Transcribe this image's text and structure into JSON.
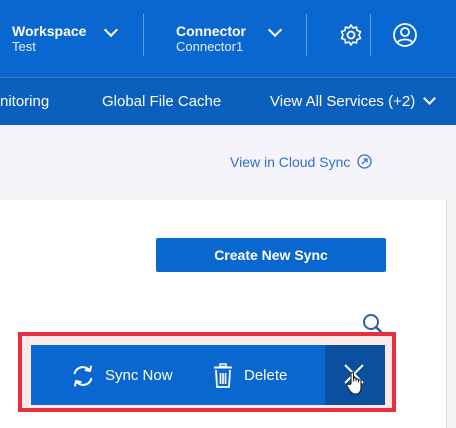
{
  "topbar": {
    "workspace": {
      "title": "Workspace",
      "value": "Test"
    },
    "connector": {
      "title": "Connector",
      "value": "Connector1"
    },
    "icons": [
      "gear-icon",
      "user-icon",
      "chevron-down-icon"
    ]
  },
  "nav": {
    "items": [
      {
        "label": "nitoring"
      },
      {
        "label": "Global File Cache"
      },
      {
        "label": "View All Services (+2)"
      }
    ]
  },
  "header_link": {
    "label": "View in Cloud Sync",
    "icon": "external-link-icon"
  },
  "create_button": {
    "label": "Create New Sync"
  },
  "action_bar": {
    "sync_now": {
      "label": "Sync Now",
      "icon": "sync-icon"
    },
    "delete": {
      "label": "Delete",
      "icon": "trash-icon"
    },
    "close": {
      "icon": "close-icon"
    }
  },
  "colors": {
    "primary": "#0a67cf",
    "nav": "#0b5fbd",
    "highlight": "#e52f3f",
    "link": "#2f6fd1"
  }
}
